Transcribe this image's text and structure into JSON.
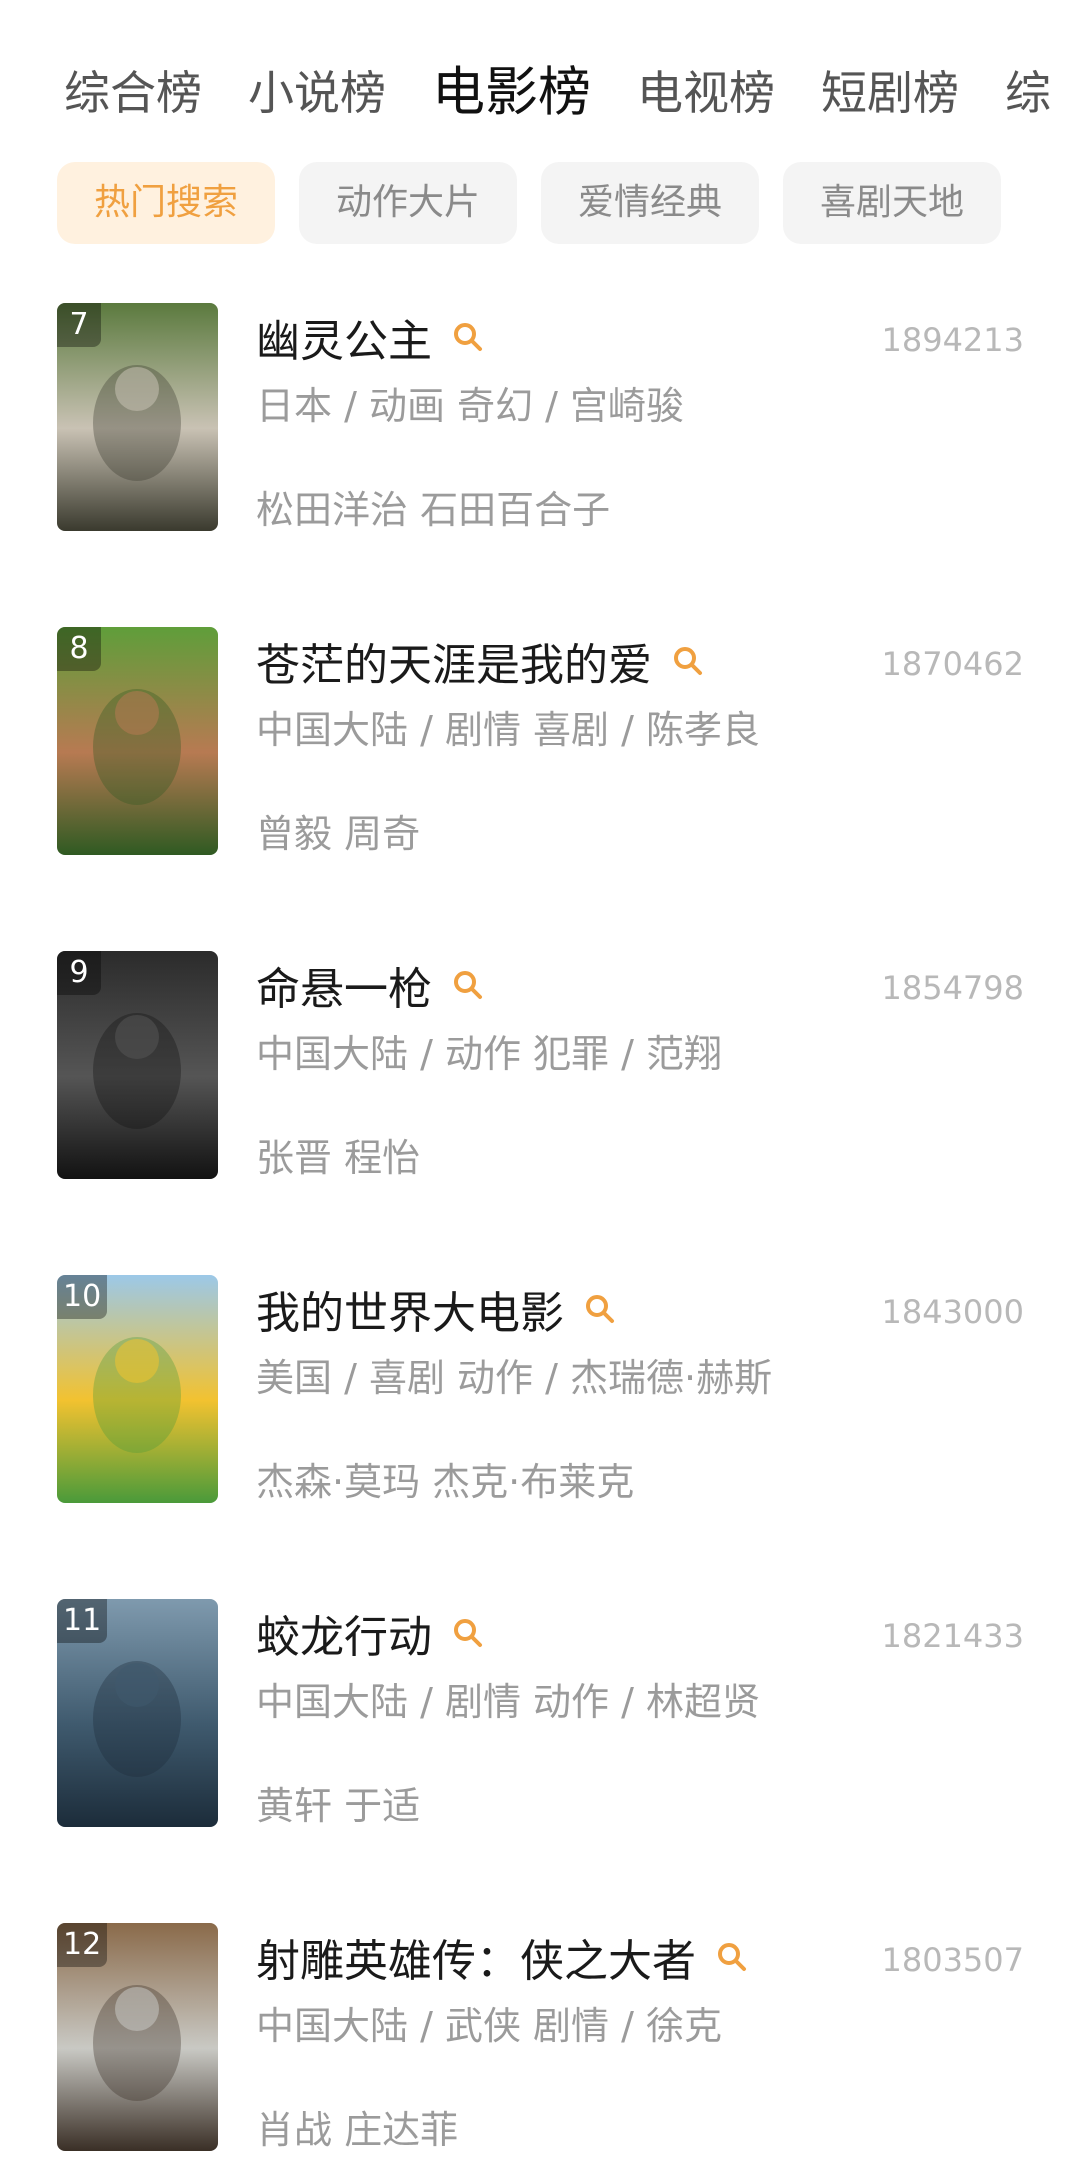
{
  "tabs": [
    "综合榜",
    "小说榜",
    "电影榜",
    "电视榜",
    "短剧榜",
    "综"
  ],
  "active_tab": 2,
  "chips": [
    "热门搜索",
    "动作大片",
    "爱情经典",
    "喜剧天地"
  ],
  "active_chip": 0,
  "accent_color": "#f0a040",
  "movies": [
    {
      "rank": "7",
      "title": "幽灵公主",
      "count": "1894213",
      "meta": "日本 / 动画 奇幻 / 宫崎骏",
      "cast": "松田洋治 石田百合子",
      "poster_colors": [
        "#5b7a3e",
        "#c9c2b4",
        "#3a3a2e"
      ]
    },
    {
      "rank": "8",
      "title": "苍茫的天涯是我的爱",
      "count": "1870462",
      "meta": "中国大陆 / 剧情 喜剧 / 陈孝良",
      "cast": "曾毅 周奇",
      "poster_colors": [
        "#5f9e3a",
        "#b77a52",
        "#2f5a22"
      ]
    },
    {
      "rank": "9",
      "title": "命悬一枪",
      "count": "1854798",
      "meta": "中国大陆 / 动作 犯罪 / 范翔",
      "cast": "张晋 程怡",
      "poster_colors": [
        "#2b2b2b",
        "#555555",
        "#121212"
      ]
    },
    {
      "rank": "10",
      "title": "我的世界大电影",
      "count": "1843000",
      "meta": "美国 / 喜剧 动作 / 杰瑞德·赫斯",
      "cast": "杰森·莫玛 杰克·布莱克",
      "poster_colors": [
        "#9cc8e8",
        "#f2c230",
        "#4a9a3a"
      ]
    },
    {
      "rank": "11",
      "title": "蛟龙行动",
      "count": "1821433",
      "meta": "中国大陆 / 剧情 动作 / 林超贤",
      "cast": "黄轩 于适",
      "poster_colors": [
        "#7f9aae",
        "#3f5a6e",
        "#1c2c3a"
      ]
    },
    {
      "rank": "12",
      "title": "射雕英雄传：侠之大者",
      "count": "1803507",
      "meta": "中国大陆 / 武侠 剧情 / 徐克",
      "cast": "肖战 庄达菲",
      "poster_colors": [
        "#8a6a4a",
        "#c9c9c4",
        "#3a2f26"
      ]
    }
  ]
}
